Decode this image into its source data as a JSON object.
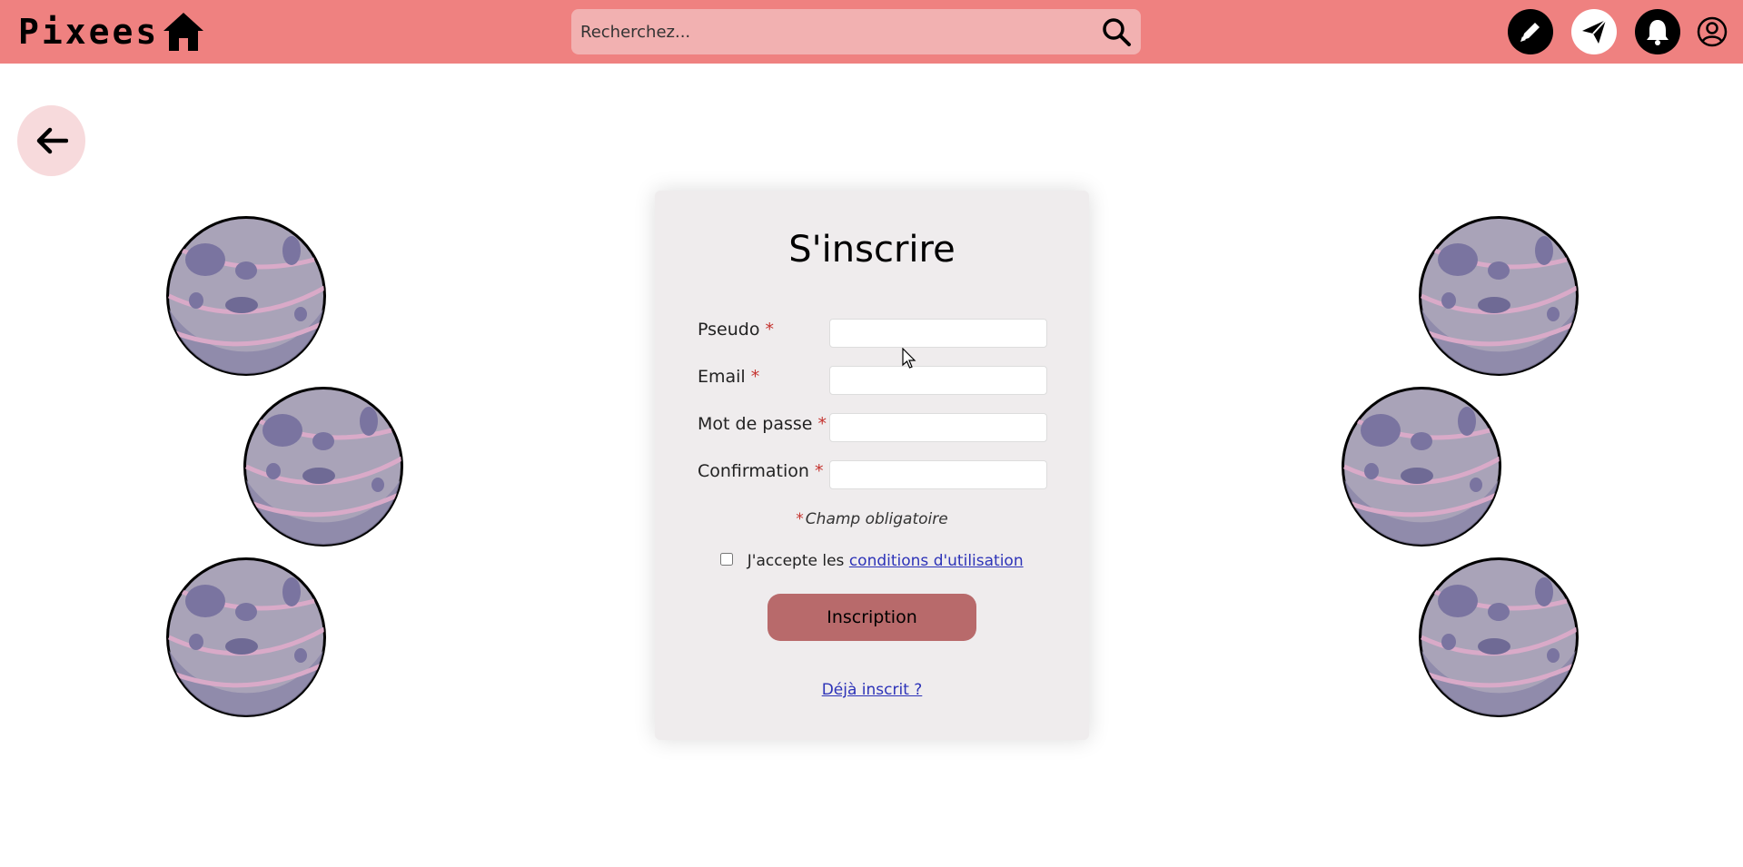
{
  "header": {
    "logo_text": "Pixees",
    "search_placeholder": "Recherchez...",
    "nav_icons": [
      "home-icon",
      "pencil-icon",
      "send-icon",
      "bell-icon",
      "user-icon"
    ],
    "background_color": "#ef8180"
  },
  "back_button": {
    "icon": "arrow-left-icon"
  },
  "form": {
    "title": "S'inscrire",
    "fields": [
      {
        "label": "Pseudo",
        "required_mark": "*",
        "value": ""
      },
      {
        "label": "Email",
        "required_mark": "*",
        "value": ""
      },
      {
        "label": "Mot de passe",
        "required_mark": "*",
        "value": ""
      },
      {
        "label": "Confirmation",
        "required_mark": "*",
        "value": ""
      }
    ],
    "required_note_mark": "*",
    "required_note": "Champ obligatoire",
    "terms_prefix": "J'accepte les",
    "terms_link": "conditions d'utilisation",
    "terms_checked": false,
    "submit_label": "Inscription",
    "login_link": "Déjà inscrit ?",
    "submit_color": "#b86a6b",
    "link_color": "#2d33b8"
  },
  "decorations": {
    "planet_icon": "planet-icon"
  }
}
